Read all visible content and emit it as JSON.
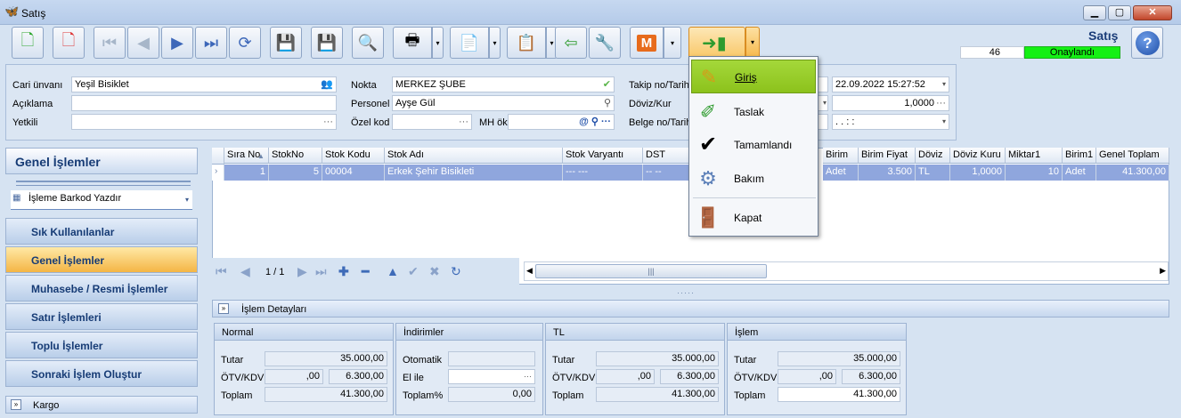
{
  "window": {
    "title": "Satış",
    "min": "▁",
    "max": "▢",
    "close": "✕"
  },
  "header": {
    "title": "Satış",
    "number": "46",
    "status": "Onaylandı",
    "status_color": "#14f014"
  },
  "form": {
    "cari_label": "Cari ünvanı",
    "cari_value": "Yeşil Bisiklet",
    "aciklama_label": "Açıklama",
    "aciklama_value": "",
    "yetkili_label": "Yetkili",
    "yetkili_value": "",
    "nokta_label": "Nokta",
    "nokta_value": "MERKEZ ŞUBE",
    "personel_label": "Personel",
    "personel_value": "Ayşe Gül",
    "ozel_label": "Özel kod",
    "ozel_value": "",
    "mhok_label": "MH ök",
    "mhok_value": "",
    "takip_label": "Takip no/Tarih",
    "takip_date": "22.09.2022 15:27:52",
    "doviz_label": "Döviz/Kur",
    "doviz_value": "1,0000",
    "belge_label": "Belge no/Tarih",
    "belge_date": ". .   : :"
  },
  "left": {
    "header": "Genel İşlemler",
    "item": "İşleme Barkod Yazdır",
    "nav": [
      "Sık Kullanılanlar",
      "Genel İşlemler",
      "Muhasebe / Resmi İşlemler",
      "Satır İşlemleri",
      "Toplu İşlemler",
      "Sonraki İşlem Oluştur"
    ],
    "kargo": "Kargo"
  },
  "grid": {
    "columns": [
      "Sıra No",
      "StokNo",
      "Stok Kodu",
      "Stok Adı",
      "Stok Varyantı",
      "DST",
      "Birim",
      "Birim Fiyat",
      "Döviz",
      "Döviz Kuru",
      "Miktar1",
      "Birim1",
      "Genel Toplam"
    ],
    "row": [
      "1",
      "5",
      "00004",
      "Erkek Şehir Bisikleti",
      "--- ---",
      "-- --",
      "Adet",
      "3.500",
      "TL",
      "1,0000",
      "10",
      "Adet",
      "41.300,00"
    ],
    "row_hidden_prefix": "0",
    "page": "1 / 1"
  },
  "details": {
    "bar": "İşlem Detayları",
    "normal": {
      "title": "Normal",
      "tutar_label": "Tutar",
      "tutar": "35.000,00",
      "otv_label": "ÖTV/KDV",
      "otv": ",00",
      "kdv": "6.300,00",
      "toplam_label": "Toplam",
      "toplam": "41.300,00"
    },
    "indirimler": {
      "title": "İndirimler",
      "oto_label": "Otomatik",
      "oto": "",
      "elile_label": "El ile",
      "elile": "",
      "toplampct_label": "Toplam%",
      "toplampct": "0,00"
    },
    "tl": {
      "title": "TL",
      "tutar_label": "Tutar",
      "tutar": "35.000,00",
      "otv_label": "ÖTV/KDV",
      "otv": ",00",
      "kdv": "6.300,00",
      "toplam_label": "Toplam",
      "toplam": "41.300,00"
    },
    "islem": {
      "title": "İşlem",
      "tutar_label": "Tutar",
      "tutar": "35.000,00",
      "otv_label": "ÖTV/KDV",
      "otv": ",00",
      "kdv": "6.300,00",
      "toplam_label": "Toplam",
      "toplam": "41.300,00"
    }
  },
  "menu": {
    "items": [
      "Giriş",
      "Taslak",
      "Tamamlandı",
      "Bakım",
      "Kapat"
    ],
    "highlight_color": "#9acd32"
  }
}
